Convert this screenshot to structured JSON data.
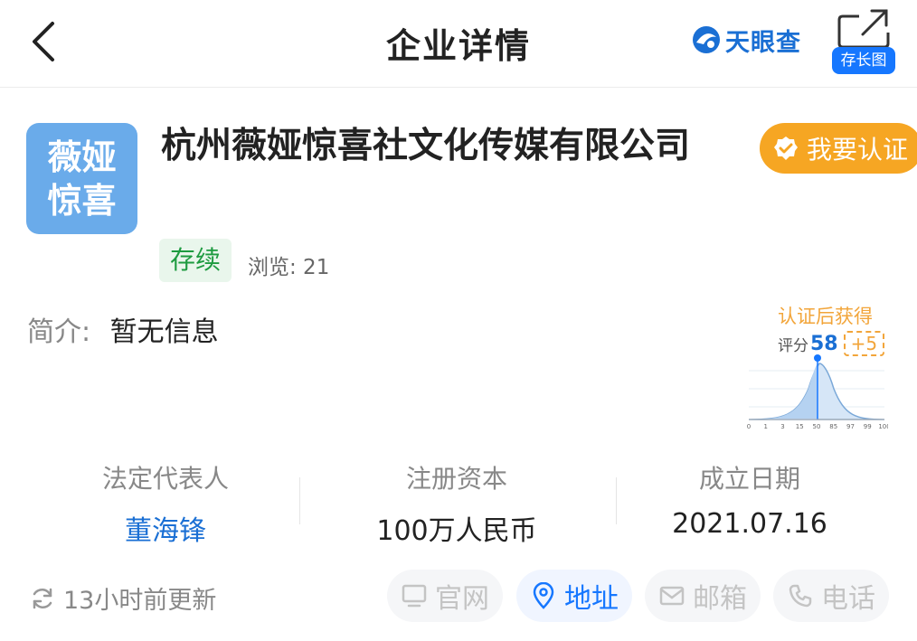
{
  "header": {
    "title": "企业详情",
    "brand_name": "天眼查",
    "share_badge": "存长图",
    "brand_color": "#1a6fd4"
  },
  "company": {
    "logo_text_line1": "薇娅",
    "logo_text_line2": "惊喜",
    "name": "杭州薇娅惊喜社文化传媒有限公司",
    "certify_label": "我要认证",
    "status": "存续",
    "views_label": "浏览: 21",
    "intro_label": "简介:",
    "intro_value": "暂无信息"
  },
  "score": {
    "title": "认证后获得",
    "label": "评分",
    "value": "58",
    "bonus": "+5",
    "axis_ticks": [
      "0",
      "1",
      "3",
      "15",
      "50",
      "85",
      "97",
      "99",
      "100"
    ]
  },
  "stats": [
    {
      "label": "法定代表人",
      "value": "董海锋"
    },
    {
      "label": "注册资本",
      "value": "100万人民币"
    },
    {
      "label": "成立日期",
      "value": "2021.07.16"
    }
  ],
  "footer": {
    "update_text": "13小时前更新",
    "actions": [
      {
        "label": "官网",
        "icon": "monitor-icon",
        "state": "disabled"
      },
      {
        "label": "地址",
        "icon": "location-pin-icon",
        "state": "active"
      },
      {
        "label": "邮箱",
        "icon": "mail-icon",
        "state": "disabled"
      },
      {
        "label": "电话",
        "icon": "phone-icon",
        "state": "disabled"
      }
    ]
  },
  "colors": {
    "accent_blue": "#1677ff",
    "certify_orange": "#f6a623",
    "status_green": "#1e9b40",
    "logo_blue": "#6aabea"
  }
}
